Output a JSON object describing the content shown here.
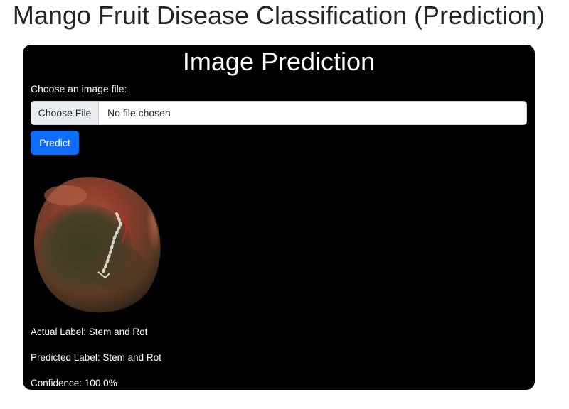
{
  "page": {
    "title": "Mango Fruit Disease Classification (Prediction)"
  },
  "card": {
    "title": "Image Prediction",
    "file_label": "Choose an image file:",
    "file_button_label": "Choose File",
    "file_status": "No file chosen",
    "predict_label": "Predict",
    "image_icon": "mango-photo",
    "results": {
      "actual": "Actual Label: Stem and Rot",
      "predicted": "Predicted Label: Stem and Rot",
      "confidence": "Confidence: 100.0%"
    }
  },
  "colors": {
    "card_background": "#000000",
    "primary_button": "#0d6efd",
    "title_text": "#212529"
  }
}
